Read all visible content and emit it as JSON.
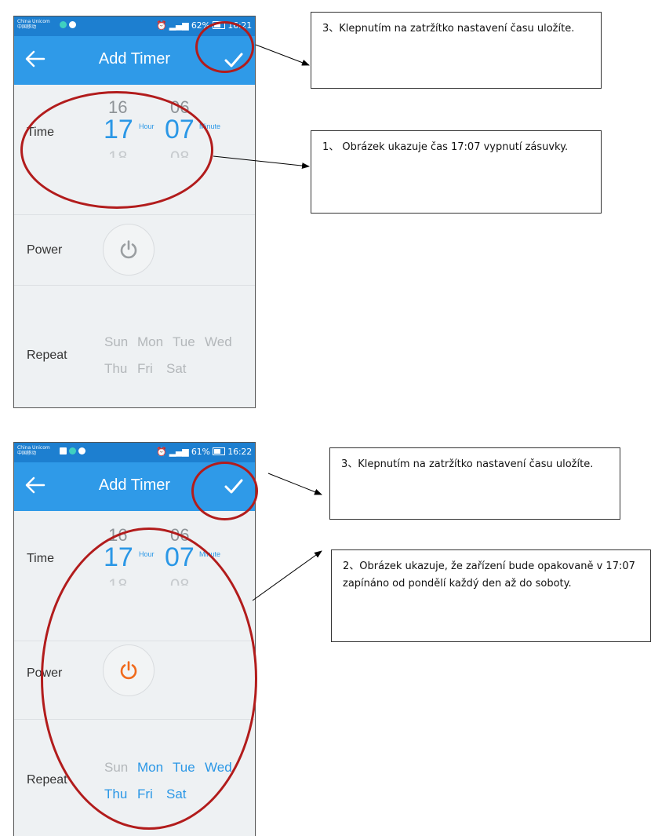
{
  "screens": [
    {
      "status": {
        "carrier1": "China Unicom",
        "carrier2": "中国移动",
        "battery": "62%",
        "time": "16:21",
        "battery_fill": 0.62
      },
      "title": "Add Timer",
      "time_label": "Time",
      "hour_above": "16",
      "hour": "17",
      "hour_below": "18",
      "hour_unit": "Hour",
      "minute_above": "06",
      "minute": "07",
      "minute_below": "08",
      "minute_unit": "Minute",
      "power_label": "Power",
      "power_on": false,
      "repeat_label": "Repeat",
      "days": [
        {
          "label": "Sun",
          "selected": false
        },
        {
          "label": "Mon",
          "selected": false
        },
        {
          "label": "Tue",
          "selected": false
        },
        {
          "label": "Wed",
          "selected": false
        },
        {
          "label": "Thu",
          "selected": false
        },
        {
          "label": "Fri",
          "selected": false
        },
        {
          "label": "Sat",
          "selected": false
        }
      ]
    },
    {
      "status": {
        "carrier1": "China Unicom",
        "carrier2": "中国移动",
        "battery": "61%",
        "time": "16:22",
        "battery_fill": 0.61
      },
      "title": "Add Timer",
      "time_label": "Time",
      "hour_above": "16",
      "hour": "17",
      "hour_below": "18",
      "hour_unit": "Hour",
      "minute_above": "06",
      "minute": "07",
      "minute_below": "08",
      "minute_unit": "Minute",
      "power_label": "Power",
      "power_on": true,
      "repeat_label": "Repeat",
      "days": [
        {
          "label": "Sun",
          "selected": false
        },
        {
          "label": "Mon",
          "selected": true
        },
        {
          "label": "Tue",
          "selected": true
        },
        {
          "label": "Wed",
          "selected": true
        },
        {
          "label": "Thu",
          "selected": true
        },
        {
          "label": "Fri",
          "selected": true
        },
        {
          "label": "Sat",
          "selected": true
        }
      ]
    }
  ],
  "notes": {
    "note_save_1": "3、Klepnutím na zatržítko nastavení času uložíte.",
    "note_time": "1、 Obrázek ukazuje čas 17:07 vypnutí zásuvky.",
    "note_save_2": "3、Klepnutím na zatržítko nastavení času uložíte.",
    "note_repeat": "2、Obrázek ukazuje, že zařízení bude opakovaně v 17:07 zapínáno od pondělí každý den až do soboty."
  },
  "colors": {
    "appbar": "#2f9ae8",
    "statusbar": "#1d7fd0",
    "accent": "#2a97e6",
    "power_on": "#f06a1c",
    "power_off": "#9a9ea1",
    "ring": "#b21c1c"
  },
  "icons": {
    "back": "arrow-left-icon",
    "save": "checkmark-icon",
    "power": "power-icon"
  }
}
